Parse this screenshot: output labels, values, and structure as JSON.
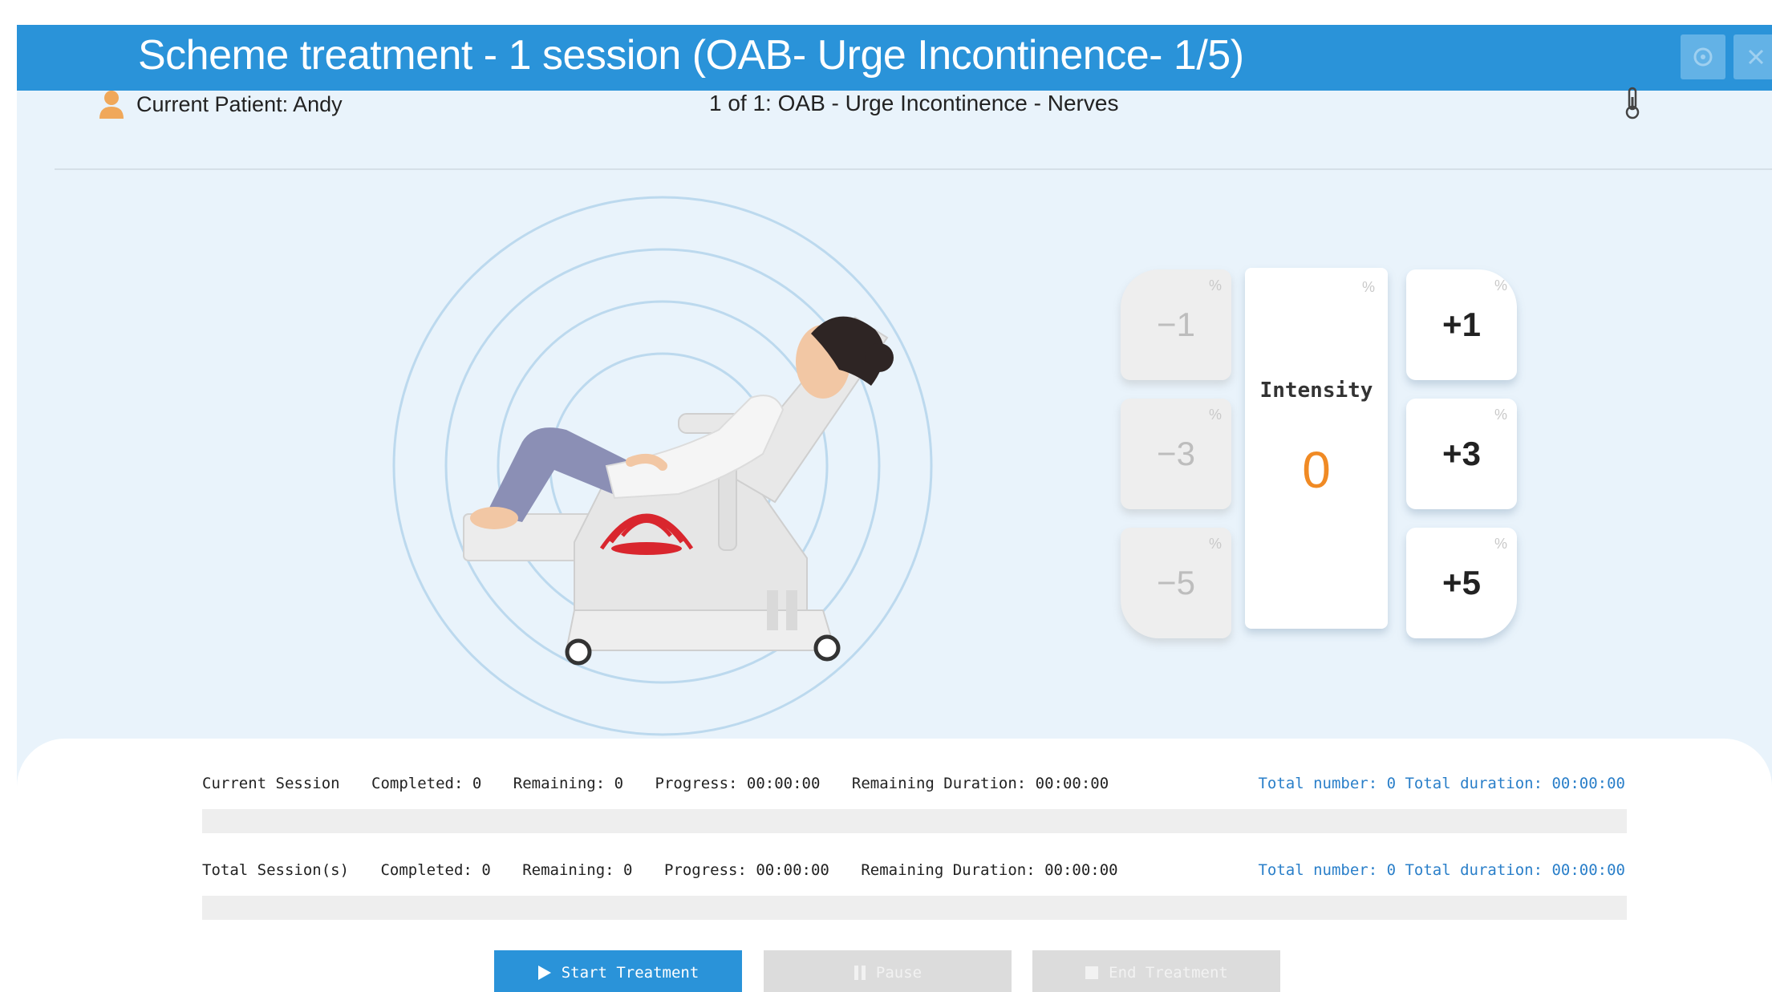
{
  "window": {
    "title": "Scheme treatment - 1 session (OAB- Urge Incontinence- 1/5)"
  },
  "header": {
    "patient_label": "Current Patient: Andy",
    "scheme_name": "1 of 1: OAB - Urge Incontinence - Nerves"
  },
  "controls": {
    "intensity_label": "Intensity",
    "intensity_value": "0",
    "percent_symbol": "%",
    "buttons": {
      "minus1": "−1",
      "minus3": "−3",
      "minus5": "−5",
      "plus1": "+1",
      "plus3": "+3",
      "plus5": "+5"
    }
  },
  "current_session": {
    "label": "Current Session",
    "completed": "Completed: 0",
    "remaining": "Remaining:  0",
    "progress": "Progress: 00:00:00",
    "remaining_duration": "Remaining Duration:  00:00:00",
    "totals": "Total number:  0 Total duration:  00:00:00",
    "progress_fraction": 0
  },
  "total_sessions": {
    "label": "Total Session(s)",
    "completed": "Completed: 0",
    "remaining": "Remaining:  0",
    "progress": "Progress: 00:00:00",
    "remaining_duration": "Remaining Duration:  00:00:00",
    "totals": "Total number:  0 Total duration:  00:00:00",
    "progress_fraction": 0
  },
  "actions": {
    "start": "Start Treatment",
    "pause": "Pause",
    "end": "End Treatment"
  },
  "icons": {
    "window_btn_1": "settings-icon",
    "window_btn_2": "close-icon",
    "patient": "user-icon",
    "thermometer": "thermometer-icon",
    "start": "play-icon",
    "pause": "pause-icon",
    "end": "stop-icon"
  },
  "colors": {
    "titlebar": "#2a93d9",
    "accent": "#2a93d9",
    "intensity_value": "#f08a24",
    "coil": "#d9262e"
  }
}
